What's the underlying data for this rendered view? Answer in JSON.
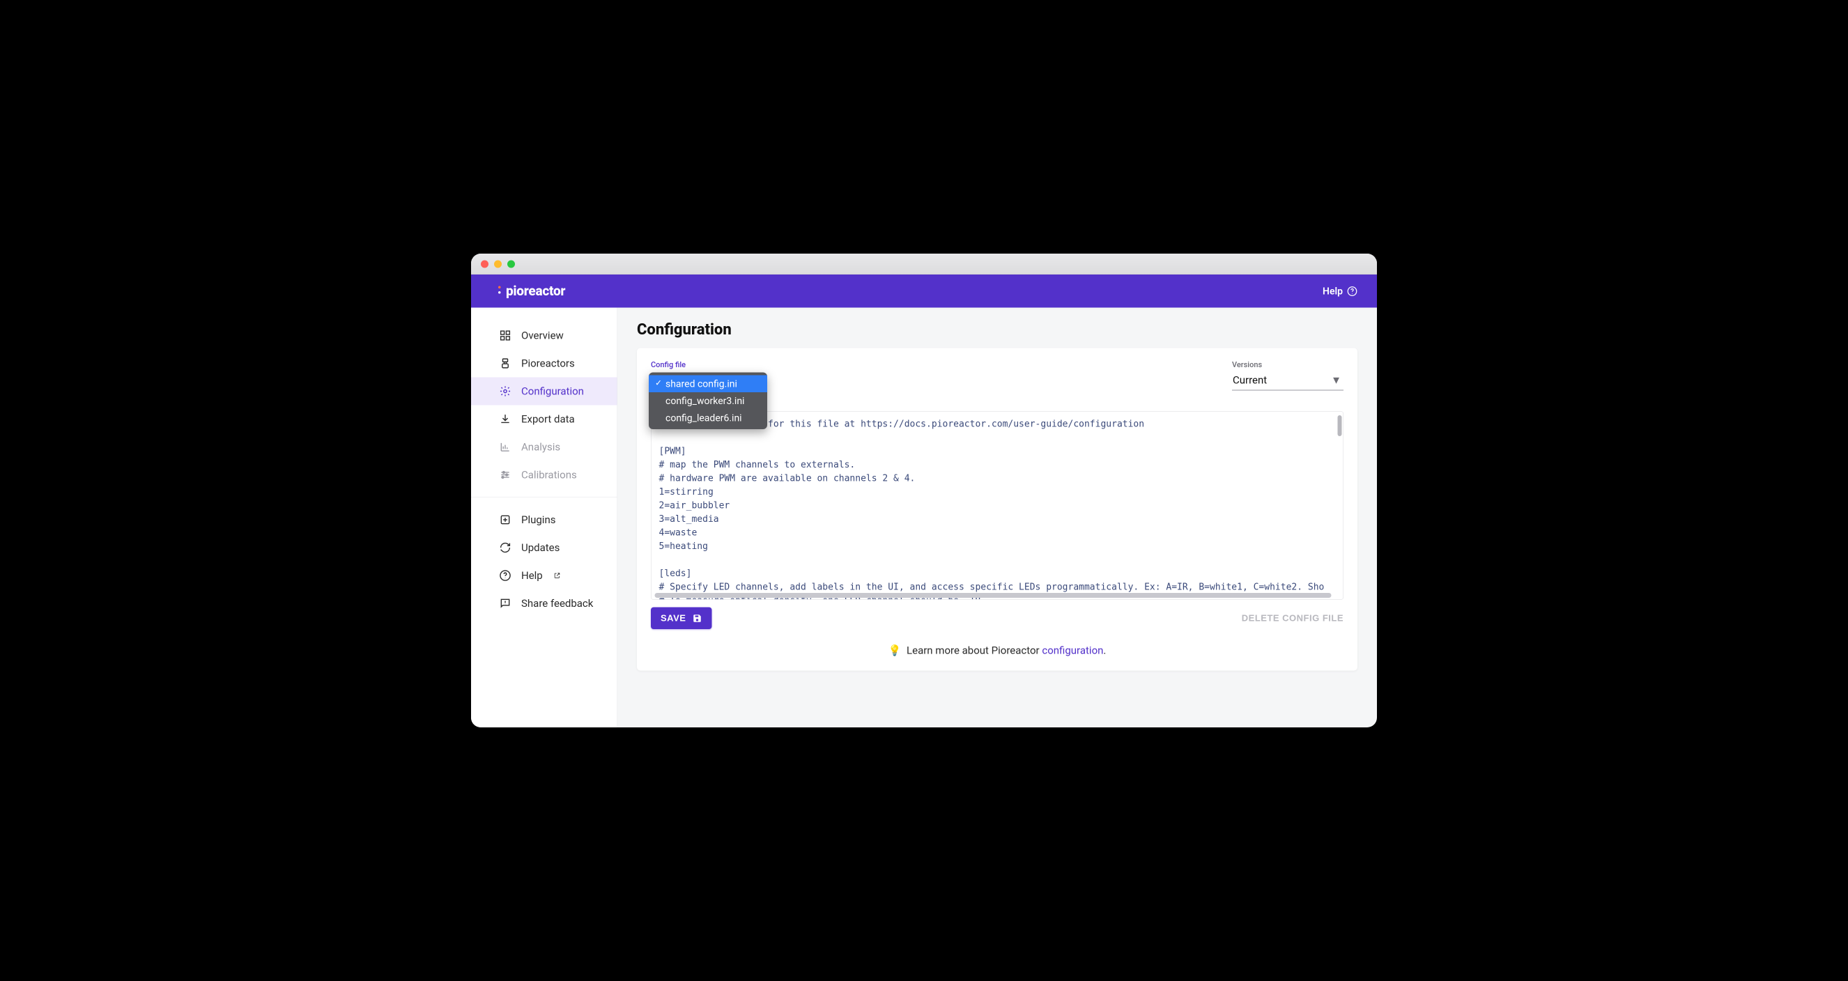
{
  "appbar": {
    "brand": "pioreactor",
    "help_label": "Help"
  },
  "sidebar": {
    "main": [
      {
        "icon": "dashboard",
        "label": "Overview"
      },
      {
        "icon": "pioreactors",
        "label": "Pioreactors"
      },
      {
        "icon": "gear",
        "label": "Configuration",
        "active": true
      },
      {
        "icon": "download",
        "label": "Export data"
      },
      {
        "icon": "chart",
        "label": "Analysis",
        "disabled": true
      },
      {
        "icon": "sliders",
        "label": "Calibrations",
        "disabled": true
      }
    ],
    "secondary": [
      {
        "icon": "plugin",
        "label": "Plugins"
      },
      {
        "icon": "refresh",
        "label": "Updates"
      },
      {
        "icon": "help",
        "label": "Help",
        "external": true
      },
      {
        "icon": "feedback",
        "label": "Share feedback"
      }
    ]
  },
  "page": {
    "title": "Configuration"
  },
  "config_file": {
    "label": "Config file",
    "options": [
      {
        "label": "shared config.ini",
        "selected": true
      },
      {
        "label": "config_worker3.ini"
      },
      {
        "label": "config_leader6.ini"
      }
    ]
  },
  "versions": {
    "label": "Versions",
    "value": "Current"
  },
  "editor_text": "# See documentation for this file at https://docs.pioreactor.com/user-guide/configuration\n\n[PWM]\n# map the PWM channels to externals.\n# hardware PWM are available on channels 2 & 4.\n1=stirring\n2=air_bubbler\n3=alt_media\n4=waste\n5=heating\n\n[leds]\n# Specify LED channels, add labels in the UI, and access specific LEDs programmatically. Ex: A=IR, B=white1, C=white2. Sho\n# To measure optical density, one LED channel should be `IR`.",
  "actions": {
    "save_label": "SAVE",
    "delete_label": "DELETE CONFIG FILE"
  },
  "learn_more": {
    "prefix": "Learn more about Pioreactor ",
    "link_text": "configuration",
    "suffix": "."
  }
}
